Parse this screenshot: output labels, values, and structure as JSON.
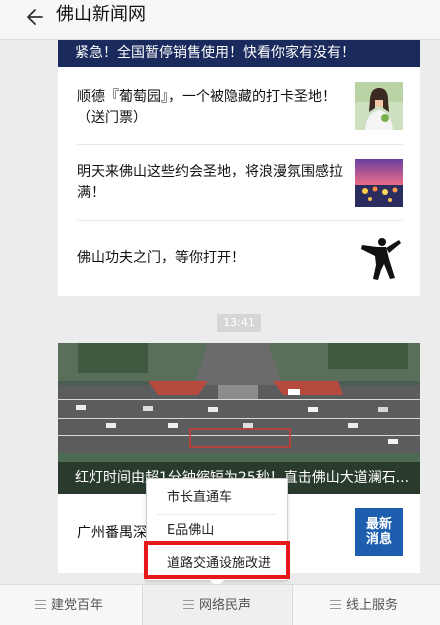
{
  "header": {
    "title": "佛山新闻网",
    "back_icon": "back-arrow-icon"
  },
  "card1": {
    "banner": "紧急！全国暂停销售使用！快看你家有没有！",
    "items": [
      {
        "text": "顺德『葡萄园』，一个被隐藏的打卡圣地！（送门票）",
        "thumb_icon": "woman-photo"
      },
      {
        "text": "明天来佛山这些约会圣地，将浪漫氛围感拉满！",
        "thumb_icon": "festival-night-photo"
      },
      {
        "text": "佛山功夫之门，等你打开！",
        "thumb_icon": "kungfu-silhouette"
      }
    ]
  },
  "timestamp": "13:41",
  "card2": {
    "hero_caption": "红灯时间由超1分钟缩短为25秒！直击佛山大道澜石...",
    "item_text": "广州番禺深",
    "item_text_tail": "声",
    "thumb_text": [
      "最新",
      "消息"
    ]
  },
  "popup": {
    "items": [
      "市长直通车",
      "E品佛山",
      "道路交通设施改进"
    ],
    "highlighted_index": 2
  },
  "tabbar": {
    "tabs": [
      "建党百年",
      "网络民声",
      "线上服务"
    ],
    "active_index": 1
  },
  "colors": {
    "banner_bg": "#1b2a5c",
    "highlight": "#e8171b",
    "thumb_blue": "#1d5fae"
  }
}
